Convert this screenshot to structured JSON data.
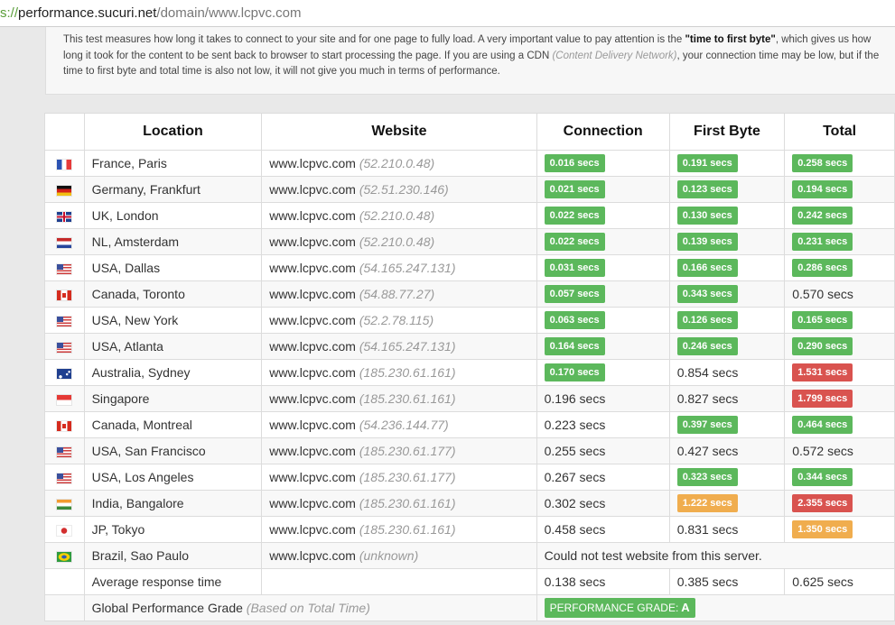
{
  "browser": {
    "url_protocol": "s://",
    "url_host": "performance.sucuri.net",
    "url_path": "/domain/www.lcpvc.com"
  },
  "description": {
    "part1": "This test measures how long it takes to connect to your site and for one page to fully load. A very important value to pay attention is the ",
    "emphasis": "\"time to first byte\"",
    "part2": ", which gives us how long it took for the content to be sent back to browser to start processing the page. If you are using a CDN ",
    "cdn_note": "(Content Delivery Network)",
    "part3": ", your connection time may be low, but if the time to first byte and total time is also not low, it will not give you much in terms of performance."
  },
  "table": {
    "headers": {
      "location": "Location",
      "website": "Website",
      "connection": "Connection",
      "first_byte": "First Byte",
      "total": "Total"
    },
    "rows": [
      {
        "flag": "fr",
        "location": "France, Paris",
        "site": "www.lcpvc.com",
        "ip": "(52.210.0.48)",
        "connection": {
          "text": "0.016 secs",
          "style": "green"
        },
        "first_byte": {
          "text": "0.191 secs",
          "style": "green"
        },
        "total": {
          "text": "0.258 secs",
          "style": "green"
        }
      },
      {
        "flag": "de",
        "location": "Germany, Frankfurt",
        "site": "www.lcpvc.com",
        "ip": "(52.51.230.146)",
        "connection": {
          "text": "0.021 secs",
          "style": "green"
        },
        "first_byte": {
          "text": "0.123 secs",
          "style": "green"
        },
        "total": {
          "text": "0.194 secs",
          "style": "green"
        }
      },
      {
        "flag": "uk",
        "location": "UK, London",
        "site": "www.lcpvc.com",
        "ip": "(52.210.0.48)",
        "connection": {
          "text": "0.022 secs",
          "style": "green"
        },
        "first_byte": {
          "text": "0.130 secs",
          "style": "green"
        },
        "total": {
          "text": "0.242 secs",
          "style": "green"
        }
      },
      {
        "flag": "nl",
        "location": "NL, Amsterdam",
        "site": "www.lcpvc.com",
        "ip": "(52.210.0.48)",
        "connection": {
          "text": "0.022 secs",
          "style": "green"
        },
        "first_byte": {
          "text": "0.139 secs",
          "style": "green"
        },
        "total": {
          "text": "0.231 secs",
          "style": "green"
        }
      },
      {
        "flag": "us",
        "location": "USA, Dallas",
        "site": "www.lcpvc.com",
        "ip": "(54.165.247.131)",
        "connection": {
          "text": "0.031 secs",
          "style": "green"
        },
        "first_byte": {
          "text": "0.166 secs",
          "style": "green"
        },
        "total": {
          "text": "0.286 secs",
          "style": "green"
        }
      },
      {
        "flag": "ca",
        "location": "Canada, Toronto",
        "site": "www.lcpvc.com",
        "ip": "(54.88.77.27)",
        "connection": {
          "text": "0.057 secs",
          "style": "green"
        },
        "first_byte": {
          "text": "0.343 secs",
          "style": "green"
        },
        "total": {
          "text": "0.570 secs",
          "style": "plain"
        }
      },
      {
        "flag": "us",
        "location": "USA, New York",
        "site": "www.lcpvc.com",
        "ip": "(52.2.78.115)",
        "connection": {
          "text": "0.063 secs",
          "style": "green"
        },
        "first_byte": {
          "text": "0.126 secs",
          "style": "green"
        },
        "total": {
          "text": "0.165 secs",
          "style": "green"
        }
      },
      {
        "flag": "us",
        "location": "USA, Atlanta",
        "site": "www.lcpvc.com",
        "ip": "(54.165.247.131)",
        "connection": {
          "text": "0.164 secs",
          "style": "green"
        },
        "first_byte": {
          "text": "0.246 secs",
          "style": "green"
        },
        "total": {
          "text": "0.290 secs",
          "style": "green"
        }
      },
      {
        "flag": "au",
        "location": "Australia, Sydney",
        "site": "www.lcpvc.com",
        "ip": "(185.230.61.161)",
        "connection": {
          "text": "0.170 secs",
          "style": "green"
        },
        "first_byte": {
          "text": "0.854 secs",
          "style": "plain"
        },
        "total": {
          "text": "1.531 secs",
          "style": "red"
        }
      },
      {
        "flag": "sg",
        "location": "Singapore",
        "site": "www.lcpvc.com",
        "ip": "(185.230.61.161)",
        "connection": {
          "text": "0.196 secs",
          "style": "plain"
        },
        "first_byte": {
          "text": "0.827 secs",
          "style": "plain"
        },
        "total": {
          "text": "1.799 secs",
          "style": "red"
        }
      },
      {
        "flag": "ca",
        "location": "Canada, Montreal",
        "site": "www.lcpvc.com",
        "ip": "(54.236.144.77)",
        "connection": {
          "text": "0.223 secs",
          "style": "plain"
        },
        "first_byte": {
          "text": "0.397 secs",
          "style": "green"
        },
        "total": {
          "text": "0.464 secs",
          "style": "green"
        }
      },
      {
        "flag": "us",
        "location": "USA, San Francisco",
        "site": "www.lcpvc.com",
        "ip": "(185.230.61.177)",
        "connection": {
          "text": "0.255 secs",
          "style": "plain"
        },
        "first_byte": {
          "text": "0.427 secs",
          "style": "plain"
        },
        "total": {
          "text": "0.572 secs",
          "style": "plain"
        }
      },
      {
        "flag": "us",
        "location": "USA, Los Angeles",
        "site": "www.lcpvc.com",
        "ip": "(185.230.61.177)",
        "connection": {
          "text": "0.267 secs",
          "style": "plain"
        },
        "first_byte": {
          "text": "0.323 secs",
          "style": "green"
        },
        "total": {
          "text": "0.344 secs",
          "style": "green"
        }
      },
      {
        "flag": "in",
        "location": "India, Bangalore",
        "site": "www.lcpvc.com",
        "ip": "(185.230.61.161)",
        "connection": {
          "text": "0.302 secs",
          "style": "plain"
        },
        "first_byte": {
          "text": "1.222 secs",
          "style": "orange"
        },
        "total": {
          "text": "2.355 secs",
          "style": "red"
        }
      },
      {
        "flag": "jp",
        "location": "JP, Tokyo",
        "site": "www.lcpvc.com",
        "ip": "(185.230.61.161)",
        "connection": {
          "text": "0.458 secs",
          "style": "plain"
        },
        "first_byte": {
          "text": "0.831 secs",
          "style": "plain"
        },
        "total": {
          "text": "1.350 secs",
          "style": "orange"
        }
      }
    ],
    "failed_row": {
      "flag": "br",
      "location": "Brazil, Sao Paulo",
      "site": "www.lcpvc.com",
      "ip": "(unknown)",
      "message": "Could not test website from this server."
    },
    "average": {
      "label": "Average response time",
      "connection": "0.138 secs",
      "first_byte": "0.385 secs",
      "total": "0.625 secs"
    },
    "grade": {
      "label": "Global Performance Grade",
      "note": "(Based on Total Time)",
      "badge_label": "PERFORMANCE GRADE:",
      "badge_value": "A"
    }
  },
  "colors": {
    "green": "#5cb85c",
    "red": "#d9534f",
    "orange": "#f0ad4e"
  }
}
